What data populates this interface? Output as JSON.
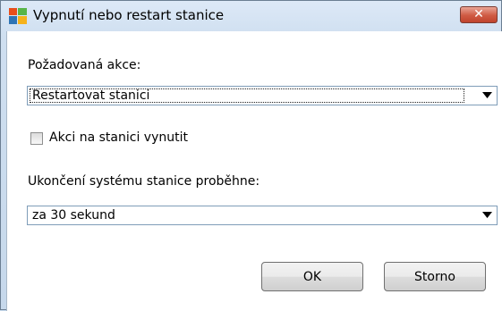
{
  "window": {
    "title": "Vypnutí nebo restart stanice",
    "icon": "avg-logo-icon",
    "close_icon": "close-icon"
  },
  "action": {
    "label": "Požadovaná akce:",
    "selected": "Restartovat stanici"
  },
  "force": {
    "label": "Akci na stanici vynutit",
    "checked": false
  },
  "shutdown": {
    "label": "Ukončení systému stanice proběhne:",
    "selected": "za 30 sekund"
  },
  "buttons": {
    "ok": "OK",
    "cancel": "Storno"
  },
  "colors": {
    "title_bg": "#d3e2f2",
    "close_red": "#c94c34",
    "dialog_bg": "#ffffff"
  }
}
